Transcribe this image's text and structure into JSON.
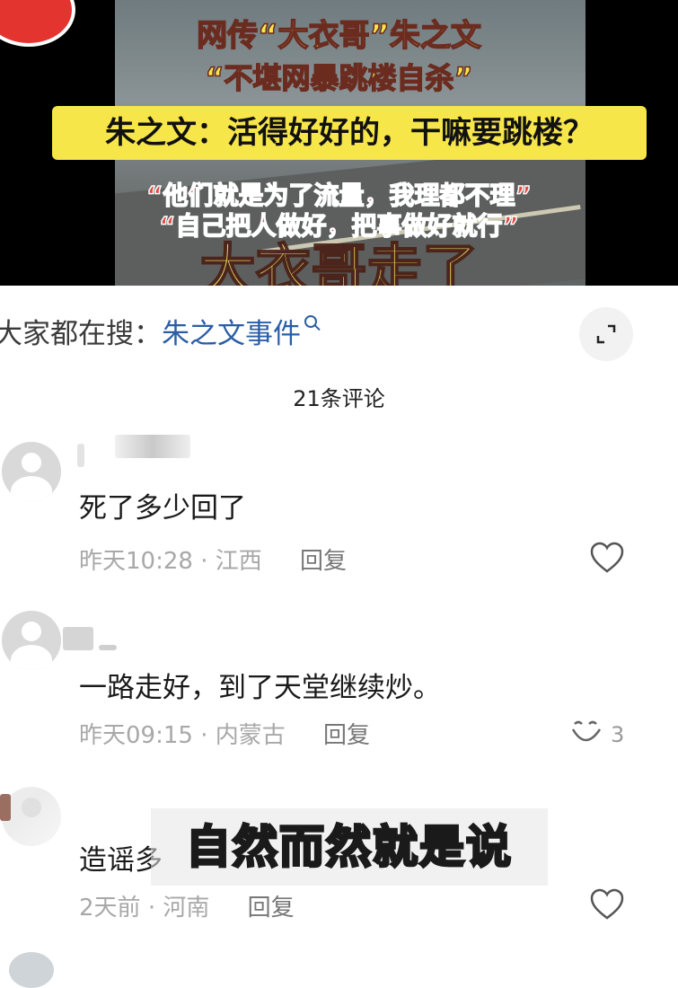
{
  "video": {
    "headline_line1": "网传“大衣哥”朱之文",
    "headline_line2": "“不堪网暴跳楼自杀”",
    "yellow_box": "朱之文：活得好好的，干嘛要跳楼？",
    "quote_line1": "“他们就是为了流量，我理都不理”",
    "quote_line2": "“自己把人做好，把事做好就行”",
    "big_text": "大衣哥走了"
  },
  "search": {
    "prefix": "大家都在搜：",
    "term": "朱之文事件"
  },
  "comments_count": "21条评论",
  "comments": [
    {
      "text": "死了多少回了",
      "time": "昨天10:28",
      "location": "江西",
      "reply": "回复",
      "likes": ""
    },
    {
      "text": "一路走好，到了天堂继续炒。",
      "time": "昨天09:15",
      "location": "内蒙古",
      "reply": "回复",
      "likes": "3"
    },
    {
      "text": "造谣多",
      "time": "2天前",
      "location": "河南",
      "reply": "回复",
      "likes": ""
    }
  ],
  "subtitle_overlay": "自然而然就是说",
  "colors": {
    "accent_yellow": "#f7e64a",
    "link_blue": "#2b5ea6",
    "meta_gray": "#a8a8a8"
  },
  "icons": [
    "search-icon",
    "expand-icon",
    "heart-icon",
    "laugh-icon",
    "avatar-icon"
  ]
}
